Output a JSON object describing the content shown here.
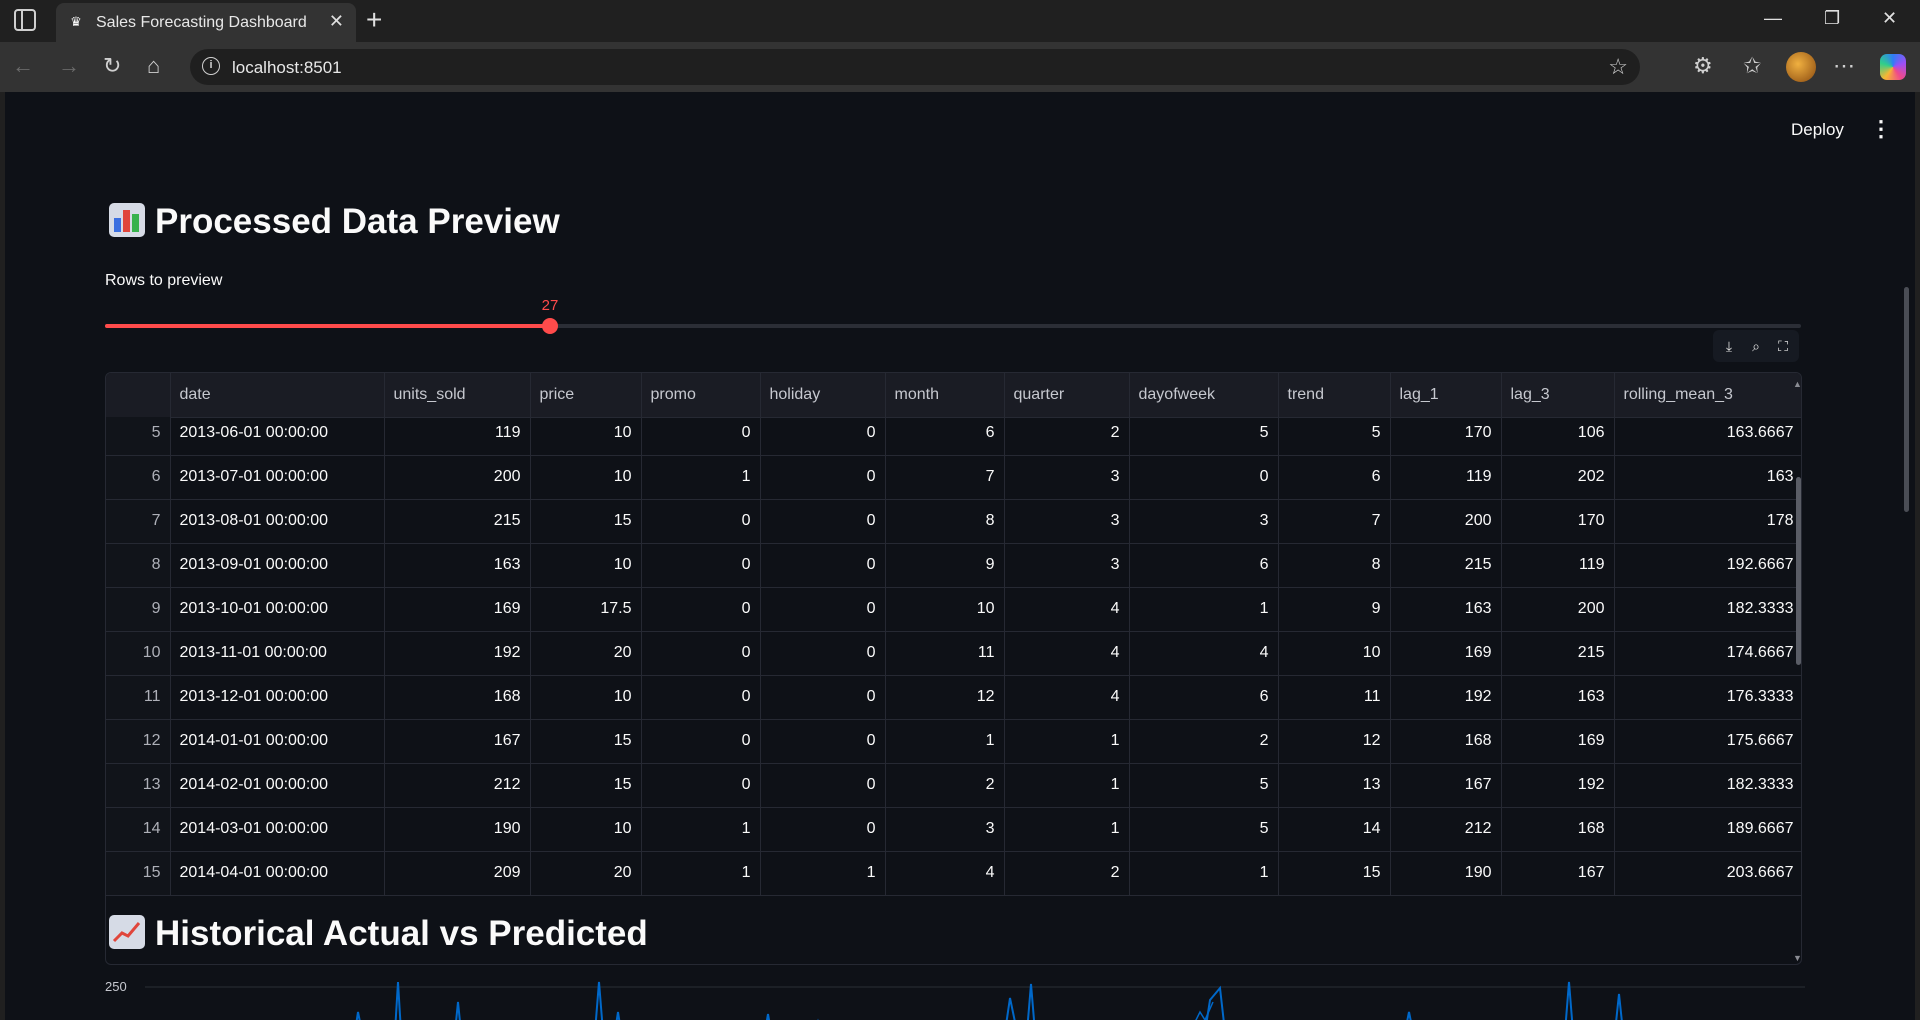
{
  "browser": {
    "tab_title": "Sales Forecasting Dashboard",
    "url": "localhost:8501"
  },
  "app": {
    "deploy_label": "Deploy",
    "section1_title": "Processed Data Preview",
    "slider": {
      "label": "Rows to preview",
      "value": 27,
      "min": 1,
      "max": 100,
      "accent": "#ff4b4b"
    },
    "section2_title": "Historical Actual vs Predicted"
  },
  "table": {
    "columns": [
      "",
      "date",
      "units_sold",
      "price",
      "promo",
      "holiday",
      "month",
      "quarter",
      "dayofweek",
      "trend",
      "lag_1",
      "lag_3",
      "rolling_mean_3"
    ],
    "rows": [
      [
        "5",
        "2013-06-01 00:00:00",
        "119",
        "10",
        "0",
        "0",
        "6",
        "2",
        "5",
        "5",
        "170",
        "106",
        "163.6667"
      ],
      [
        "6",
        "2013-07-01 00:00:00",
        "200",
        "10",
        "1",
        "0",
        "7",
        "3",
        "0",
        "6",
        "119",
        "202",
        "163"
      ],
      [
        "7",
        "2013-08-01 00:00:00",
        "215",
        "15",
        "0",
        "0",
        "8",
        "3",
        "3",
        "7",
        "200",
        "170",
        "178"
      ],
      [
        "8",
        "2013-09-01 00:00:00",
        "163",
        "10",
        "0",
        "0",
        "9",
        "3",
        "6",
        "8",
        "215",
        "119",
        "192.6667"
      ],
      [
        "9",
        "2013-10-01 00:00:00",
        "169",
        "17.5",
        "0",
        "0",
        "10",
        "4",
        "1",
        "9",
        "163",
        "200",
        "182.3333"
      ],
      [
        "10",
        "2013-11-01 00:00:00",
        "192",
        "20",
        "0",
        "0",
        "11",
        "4",
        "4",
        "10",
        "169",
        "215",
        "174.6667"
      ],
      [
        "11",
        "2013-12-01 00:00:00",
        "168",
        "10",
        "0",
        "0",
        "12",
        "4",
        "6",
        "11",
        "192",
        "163",
        "176.3333"
      ],
      [
        "12",
        "2014-01-01 00:00:00",
        "167",
        "15",
        "0",
        "0",
        "1",
        "1",
        "2",
        "12",
        "168",
        "169",
        "175.6667"
      ],
      [
        "13",
        "2014-02-01 00:00:00",
        "212",
        "15",
        "0",
        "0",
        "2",
        "1",
        "5",
        "13",
        "167",
        "192",
        "182.3333"
      ],
      [
        "14",
        "2014-03-01 00:00:00",
        "190",
        "10",
        "1",
        "0",
        "3",
        "1",
        "5",
        "14",
        "212",
        "168",
        "189.6667"
      ],
      [
        "15",
        "2014-04-01 00:00:00",
        "209",
        "20",
        "1",
        "1",
        "4",
        "2",
        "1",
        "15",
        "190",
        "167",
        "203.6667"
      ]
    ]
  },
  "chart": {
    "y_tick_label": "250",
    "line_color": "#0068c9"
  }
}
